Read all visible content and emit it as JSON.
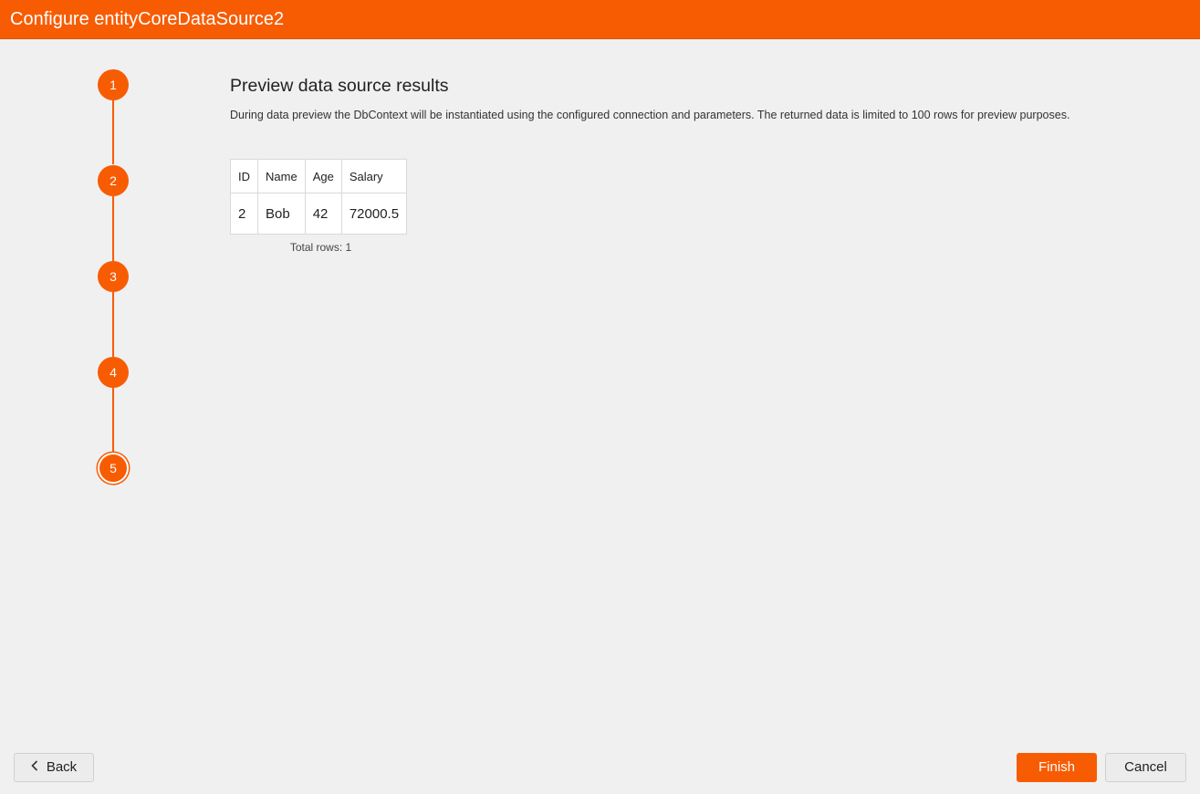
{
  "window": {
    "title": "Configure entityCoreDataSource2"
  },
  "stepper": {
    "steps": [
      {
        "label": "1"
      },
      {
        "label": "2"
      },
      {
        "label": "3"
      },
      {
        "label": "4"
      },
      {
        "label": "5"
      }
    ],
    "current": 5
  },
  "content": {
    "heading": "Preview data source results",
    "description": "During data preview the DbContext will be instantiated using the configured connection and parameters. The returned data is limited to 100 rows for preview purposes.",
    "table": {
      "columns": [
        "ID",
        "Name",
        "Age",
        "Salary"
      ],
      "rows": [
        [
          "2",
          "Bob",
          "42",
          "72000.5"
        ]
      ]
    },
    "total_rows": "Total rows: 1"
  },
  "footer": {
    "back_label": "Back",
    "back_icon": "chevron-left-icon",
    "finish_label": "Finish",
    "cancel_label": "Cancel"
  },
  "colors": {
    "accent": "#f75c03",
    "background": "#f0f0f0"
  }
}
